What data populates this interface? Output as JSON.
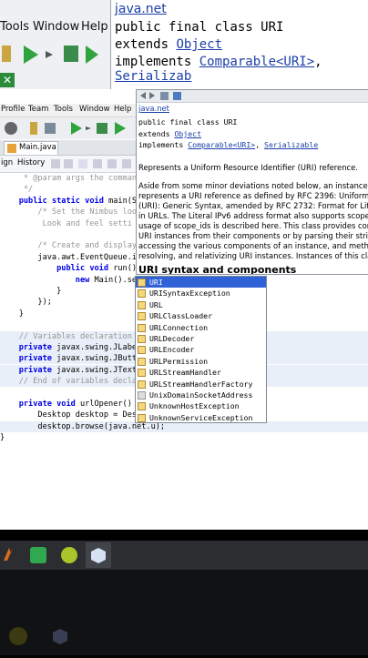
{
  "back_window": {
    "menu": [
      "Tools",
      "Window",
      "Help"
    ],
    "doc_title": "java.net",
    "doc_lines": [
      {
        "prefix": "public final class URI",
        "links": []
      },
      {
        "prefix": "extends ",
        "links": [
          "Object"
        ]
      },
      {
        "prefix": "implements ",
        "links": [
          "Comparable<URI>",
          "Serializab"
        ]
      }
    ],
    "close_label": "✕"
  },
  "ide": {
    "menu": [
      "Profile",
      "Team",
      "Tools",
      "Window",
      "Help"
    ],
    "file_tab": "Main.java",
    "editor_tabs": [
      "ign",
      "History"
    ],
    "status_item": "urlOpener"
  },
  "code_lines": [
    {
      "text": "     * @param args the comman",
      "cls": "cm",
      "hl": false
    },
    {
      "text": "     */",
      "cls": "cm",
      "hl": false
    },
    {
      "text": "    public static void main(S",
      "cls": "",
      "hl": false
    },
    {
      "text": "        /* Set the Nimbus loo",
      "cls": "cm",
      "hl": false
    },
    {
      "text": "         Look and feel setti",
      "cls": "cm",
      "hl": false
    },
    {
      "text": "",
      "cls": "",
      "hl": false
    },
    {
      "text": "        /* Create and display",
      "cls": "cm",
      "hl": false
    },
    {
      "text": "        java.awt.EventQueue.i",
      "cls": "",
      "hl": false
    },
    {
      "text": "            public void run()",
      "cls": "",
      "hl": false
    },
    {
      "text": "                new Main().se",
      "cls": "",
      "hl": false
    },
    {
      "text": "            }",
      "cls": "",
      "hl": false
    },
    {
      "text": "        });",
      "cls": "",
      "hl": false
    },
    {
      "text": "    }",
      "cls": "",
      "hl": false
    },
    {
      "text": "",
      "cls": "",
      "hl": false
    },
    {
      "text": "    // Variables declaration",
      "cls": "cm",
      "hl": true
    },
    {
      "text": "    private javax.swing.JLabe",
      "cls": "",
      "hl": true
    },
    {
      "text": "    private javax.swing.JButt",
      "cls": "",
      "hl": true
    },
    {
      "text": "    private javax.swing.JText",
      "cls": "",
      "hl": true
    },
    {
      "text": "    // End of variables decla",
      "cls": "cm",
      "hl": true
    },
    {
      "text": "",
      "cls": "",
      "hl": false
    },
    {
      "text": "    private void urlOpener()",
      "cls": "",
      "hl": false
    },
    {
      "text": "        Desktop desktop = Des",
      "cls": "",
      "hl": false
    },
    {
      "text": "        desktop.browse(java.net.u);",
      "cls": "",
      "hl": true
    },
    {
      "text": "}",
      "cls": "",
      "hl": false
    }
  ],
  "javadoc": {
    "package": "java.net",
    "decl1": "public final class URI",
    "decl2_prefix": "extends ",
    "decl2_link": "Object",
    "decl3_prefix": "implements ",
    "decl3_link1": "Comparable<URI>",
    "decl3_sep": ", ",
    "decl3_link2": "Serializable",
    "summary": "Represents a Uniform Resource Identifier (URI) reference.",
    "para": [
      "Aside from some minor deviations noted below, an instance of th",
      "represents a URI reference as defined by RFC 2396: Uniform Res",
      "(URI): Generic Syntax, amended by RFC 2732: Format for Literal",
      "in URLs. The Literal IPv6 address format also supports scope_ids",
      "usage of scope_ids is described here. This class provides constru",
      "URI instances from their components or by parsing their string fo",
      "accessing the various components of an instance, and methods fo",
      "resolving, and relativizing URI instances. Instances of this class a"
    ],
    "heading": "URI syntax and components"
  },
  "completion": {
    "items": [
      {
        "label": "URI",
        "selected": true,
        "deprecated": false
      },
      {
        "label": "URISyntaxException",
        "selected": false,
        "deprecated": false
      },
      {
        "label": "URL",
        "selected": false,
        "deprecated": false
      },
      {
        "label": "URLClassLoader",
        "selected": false,
        "deprecated": false
      },
      {
        "label": "URLConnection",
        "selected": false,
        "deprecated": false
      },
      {
        "label": "URLDecoder",
        "selected": false,
        "deprecated": false
      },
      {
        "label": "URLEncoder",
        "selected": false,
        "deprecated": false
      },
      {
        "label": "URLPermission",
        "selected": false,
        "deprecated": false
      },
      {
        "label": "URLStreamHandler",
        "selected": false,
        "deprecated": false
      },
      {
        "label": "URLStreamHandlerFactory",
        "selected": false,
        "deprecated": false
      },
      {
        "label": "UnixDomainSocketAddress",
        "selected": false,
        "deprecated": true
      },
      {
        "label": "UnknownHostException",
        "selected": false,
        "deprecated": false
      },
      {
        "label": "UnknownServiceException",
        "selected": false,
        "deprecated": false
      }
    ]
  },
  "colors": {
    "selection": "#2f61d7",
    "keyword": "#0000e6",
    "comment": "#969696",
    "link": "#1a3fa8"
  }
}
